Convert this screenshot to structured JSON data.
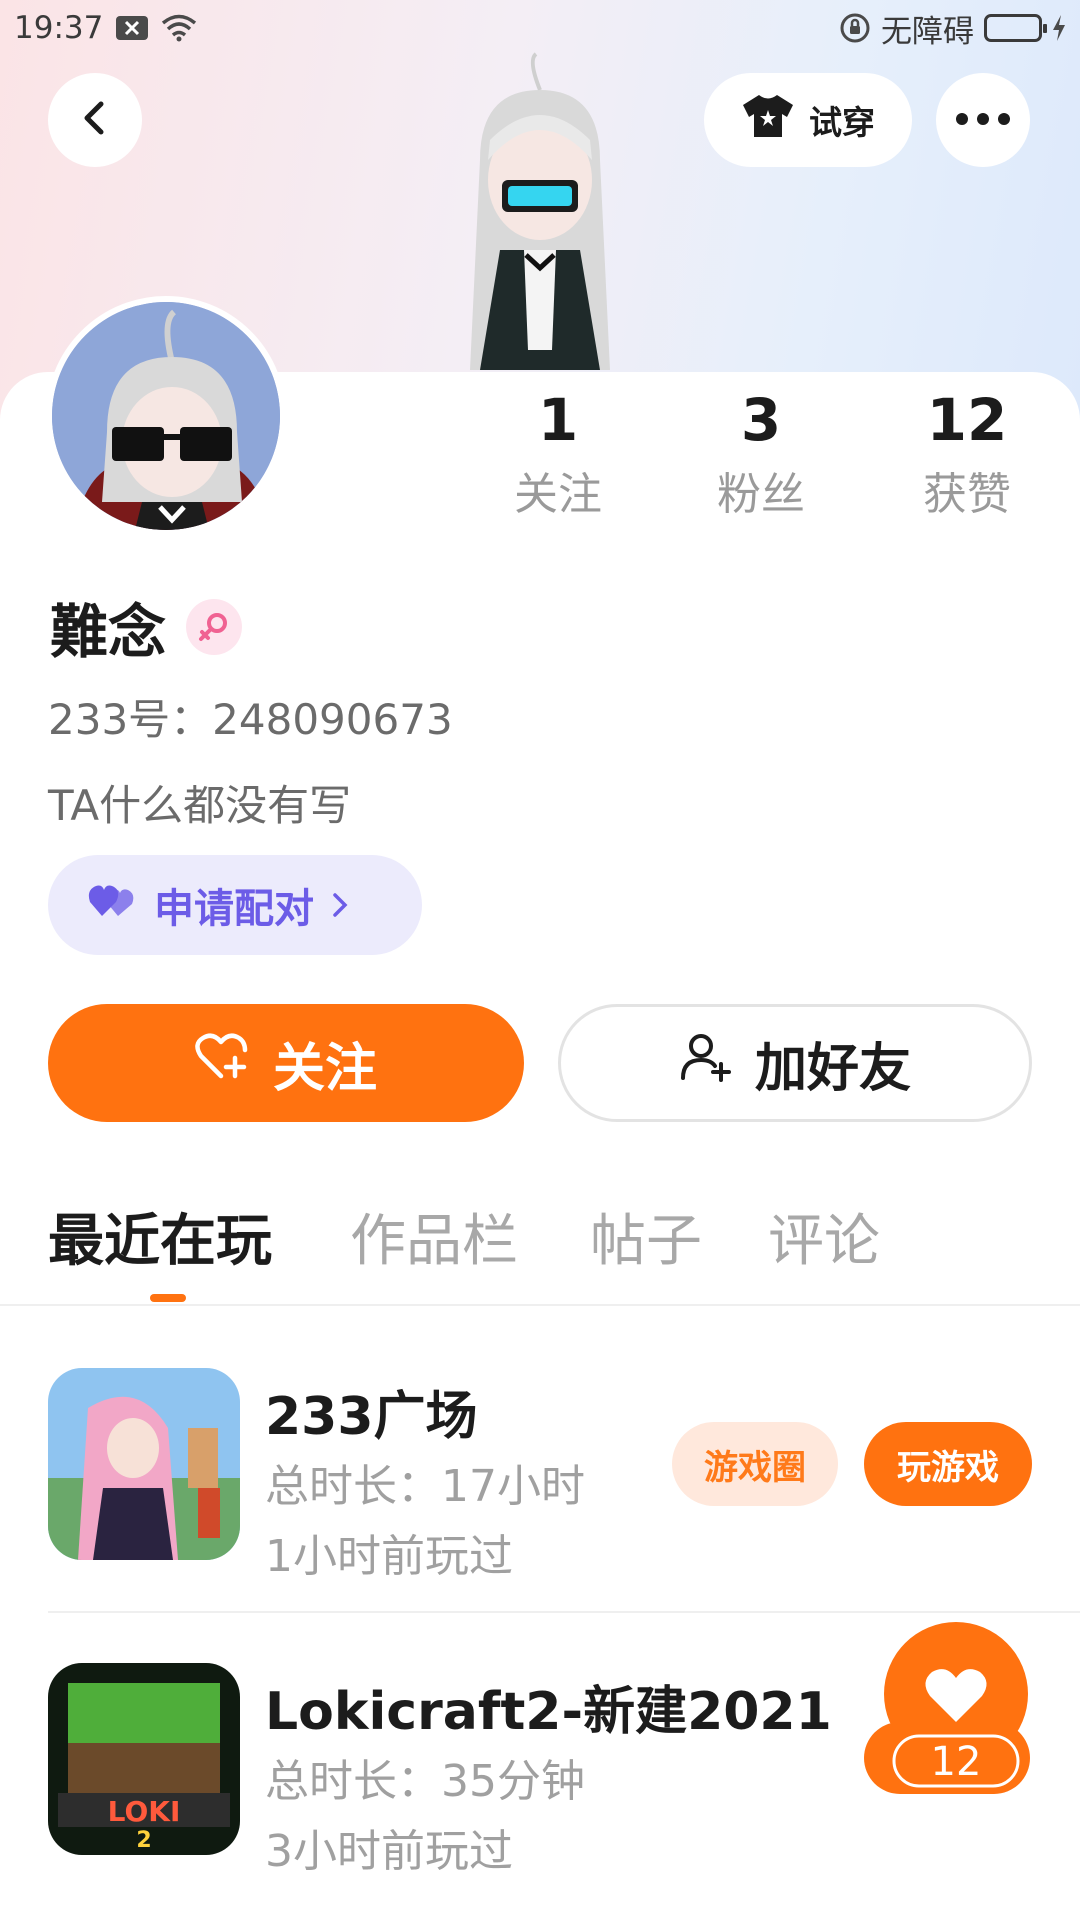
{
  "status_bar": {
    "time": "19:37",
    "accessibility_label": "无障碍"
  },
  "header": {
    "tryon_label": "试穿"
  },
  "profile": {
    "name": "難念",
    "uid_text": "233号：248090673",
    "bio": "TA什么都没有写",
    "pair_label": "申请配对",
    "stats": [
      {
        "value": "1",
        "label": "关注"
      },
      {
        "value": "3",
        "label": "粉丝"
      },
      {
        "value": "12",
        "label": "获赞"
      }
    ]
  },
  "actions": {
    "follow_label": "关注",
    "add_friend_label": "加好友"
  },
  "tabs": [
    {
      "label": "最近在玩",
      "active": true
    },
    {
      "label": "作品栏",
      "active": false
    },
    {
      "label": "帖子",
      "active": false
    },
    {
      "label": "评论",
      "active": false
    }
  ],
  "games": [
    {
      "title": "233广场",
      "duration": "总时长：17小时",
      "last_played": "1小时前玩过",
      "circle_label": "游戏圈",
      "play_label": "玩游戏"
    },
    {
      "title": "Lokicraft2-新建2021",
      "duration": "总时长：35分钟",
      "last_played": "3小时前玩过"
    }
  ],
  "like_fab": {
    "count": "12"
  },
  "colors": {
    "accent": "#ff7210",
    "pair_purple": "#6c5ce7",
    "tab_inactive": "#a8a8a8"
  }
}
